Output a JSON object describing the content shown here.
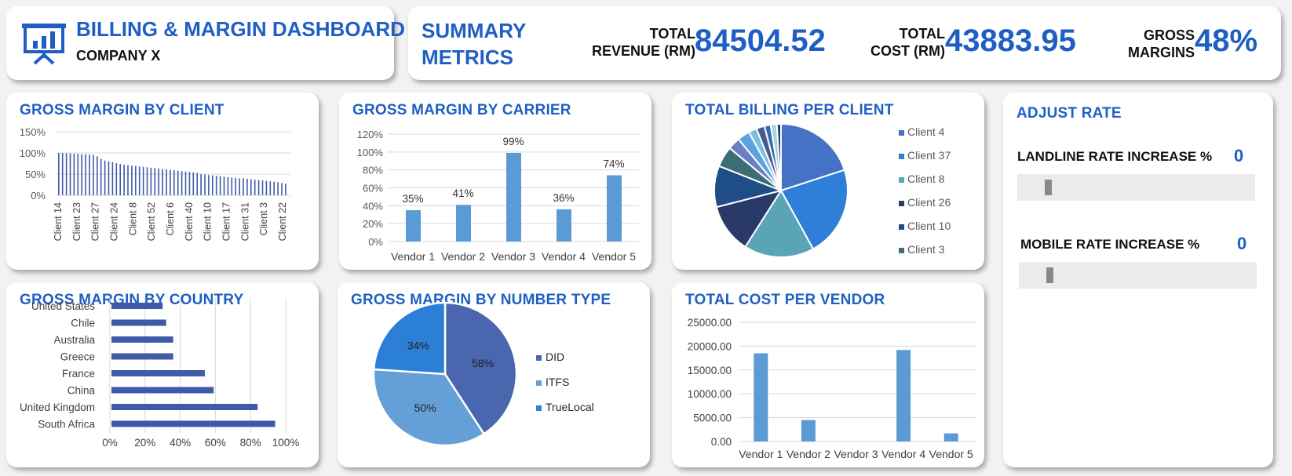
{
  "header": {
    "title": "BILLING & MARGIN DASHBOARD",
    "subtitle": "COMPANY X",
    "logo_icon": "presentation-chart-icon"
  },
  "summary": {
    "title_line1": "SUMMARY",
    "title_line2": "METRICS",
    "revenue_label_1": "TOTAL",
    "revenue_label_2": "REVENUE (RM)",
    "revenue_value": "84504.52",
    "cost_label_1": "TOTAL",
    "cost_label_2": "COST (RM)",
    "cost_value": "43883.95",
    "margin_label_1": "GROSS",
    "margin_label_2": "MARGINS",
    "margin_value": "48%"
  },
  "panels": {
    "client_margin_title": "GROSS MARGIN BY CLIENT",
    "carrier_margin_title": "GROSS MARGIN BY CARRIER",
    "billing_per_client_title": "TOTAL BILLING PER CLIENT",
    "country_margin_title": "GROSS MARGIN BY COUNTRY",
    "number_type_title": "GROSS MARGIN BY NUMBER TYPE",
    "cost_per_vendor_title": "TOTAL COST PER VENDOR"
  },
  "adjust_rate": {
    "title": "ADJUST RATE",
    "landline_label": "LANDLINE RATE INCREASE %",
    "landline_value": "0",
    "landline_slider_fraction": 0.02,
    "mobile_label": "MOBILE RATE INCREASE %",
    "mobile_value": "0",
    "mobile_slider_fraction": 0.02
  },
  "colors": {
    "accent": "#1f5fc4",
    "bar_blue": "#5b9bd5",
    "bar_navy": "#3f5ba8",
    "grid": "#d9d9d9"
  },
  "chart_data": [
    {
      "id": "client",
      "type": "bar",
      "x_tick_labels": [
        "Client 14",
        "Client 23",
        "Client 27",
        "Client 24",
        "Client 8",
        "Client 52",
        "Client 6",
        "Client 40",
        "Client 10",
        "Client 17",
        "Client 31",
        "Client 3",
        "Client 22"
      ],
      "values": [
        100,
        100,
        99,
        99,
        98,
        98,
        97,
        97,
        96,
        95,
        92,
        86,
        82,
        80,
        78,
        76,
        74,
        72,
        71,
        70,
        69,
        68,
        67,
        66,
        65,
        64,
        63,
        62,
        61,
        60,
        59,
        58,
        57,
        56,
        55,
        54,
        53,
        50,
        49,
        48,
        47,
        46,
        45,
        44,
        43,
        42,
        41,
        40,
        40,
        39,
        38,
        37,
        36,
        35,
        34,
        33,
        32,
        31,
        29,
        27
      ],
      "y_ticks": [
        "0%",
        "50%",
        "100%",
        "150%"
      ],
      "ylim": [
        0,
        150
      ],
      "grid": true
    },
    {
      "id": "carrier",
      "type": "bar",
      "categories": [
        "Vendor 1",
        "Vendor 2",
        "Vendor 3",
        "Vendor 4",
        "Vendor 5"
      ],
      "values": [
        35,
        41,
        99,
        36,
        74
      ],
      "data_labels": [
        "35%",
        "41%",
        "99%",
        "36%",
        "74%"
      ],
      "y_ticks": [
        "0%",
        "20%",
        "40%",
        "60%",
        "80%",
        "100%",
        "120%"
      ],
      "ylim": [
        0,
        120
      ],
      "grid": true
    },
    {
      "id": "billing",
      "type": "pie",
      "legend": [
        "Client 4",
        "Client 37",
        "Client 8",
        "Client 26",
        "Client 10",
        "Client 3"
      ],
      "legend_placement": "right",
      "values": [
        20,
        22,
        17,
        12,
        10,
        5,
        3,
        3,
        2,
        2,
        1.5,
        1.5,
        1
      ],
      "colors": [
        "#4472c4",
        "#2f7fd8",
        "#5aa5b5",
        "#2a3a68",
        "#1f4e86",
        "#3c6e78",
        "#6a7fc4",
        "#5ba3e0",
        "#7ec0d8",
        "#4a5a90",
        "#2f6eaa",
        "#a9d4e0",
        "#283c7a"
      ]
    },
    {
      "id": "country",
      "type": "bar",
      "orientation": "horizontal",
      "categories": [
        "United States",
        "Chile",
        "Australia",
        "Greece",
        "France",
        "China",
        "United Kingdom",
        "South Africa"
      ],
      "values": [
        30,
        32,
        36,
        36,
        54,
        59,
        84,
        94
      ],
      "x_ticks": [
        "0%",
        "20%",
        "40%",
        "60%",
        "80%",
        "100%"
      ],
      "xlim": [
        0,
        100
      ],
      "grid": true
    },
    {
      "id": "numbertype",
      "type": "pie",
      "categories": [
        "DID",
        "ITFS",
        "TrueLocal"
      ],
      "values": [
        58,
        50,
        34
      ],
      "data_labels": [
        "58%",
        "50%",
        "34%"
      ],
      "colors": [
        "#4a66ae",
        "#649fd7",
        "#2b7fd6"
      ],
      "legend_placement": "right"
    },
    {
      "id": "vendorcost",
      "type": "bar",
      "categories": [
        "Vendor 1",
        "Vendor 2",
        "Vendor 3",
        "Vendor 4",
        "Vendor 5"
      ],
      "values": [
        18500,
        4500,
        0,
        19200,
        1700
      ],
      "y_ticks": [
        "0.00",
        "5000.00",
        "10000.00",
        "15000.00",
        "20000.00",
        "25000.00"
      ],
      "ylim": [
        0,
        25000
      ],
      "grid": true
    }
  ]
}
